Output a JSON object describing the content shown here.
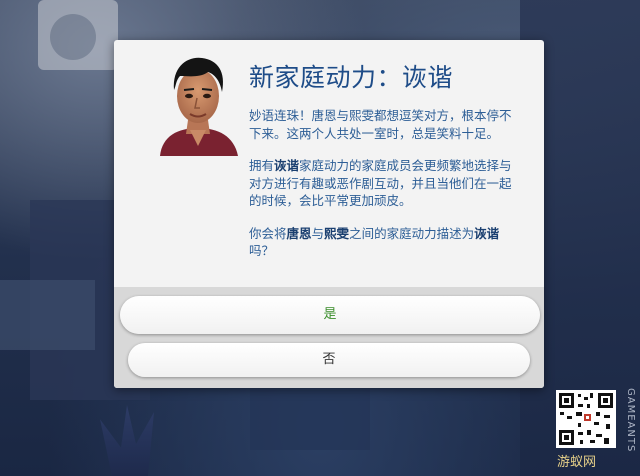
{
  "dialog": {
    "title": "新家庭动力：诙谐",
    "paragraph1": "妙语连珠！唐恩与熙雯都想逗笑对方，根本停不下来。这两个人共处一室时，总是笑料十足。",
    "paragraph2_pre": "拥有",
    "paragraph2_bold": "诙谐",
    "paragraph2_post": "家庭动力的家庭成员会更频繁地选择与对方进行有趣或恶作剧互动，并且当他们在一起的时候，会比平常更加顽皮。",
    "paragraph3_pre": "你会将",
    "paragraph3_name1": "唐恩",
    "paragraph3_mid1": "与",
    "paragraph3_name2": "熙雯",
    "paragraph3_mid2": "之间的家庭动力描述为",
    "paragraph3_bold": "诙谐",
    "paragraph3_post": "吗？",
    "yes_label": "是",
    "no_label": "否"
  },
  "watermark": {
    "brand": "GAMEANTS",
    "site": "游蚁网"
  },
  "colors": {
    "title": "#1e4c88",
    "body": "#2d5e96",
    "yes": "#3a8d2b"
  }
}
